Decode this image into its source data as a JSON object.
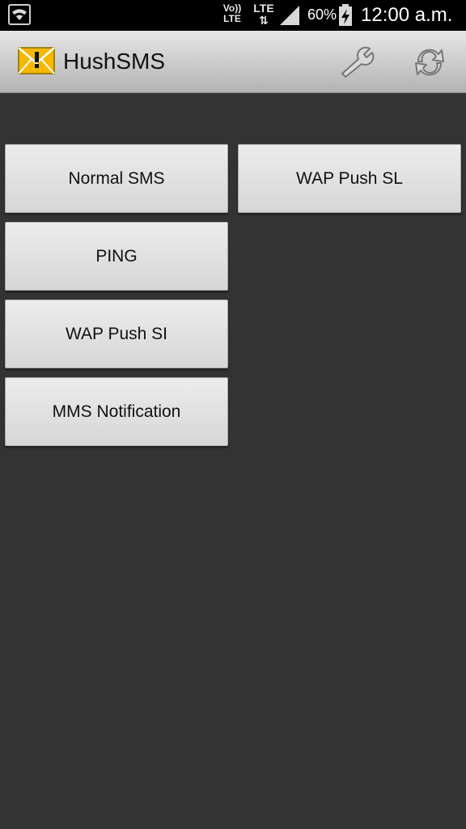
{
  "status_bar": {
    "volte": "Vo)) LTE",
    "network": "LTE",
    "battery_percent": "60%",
    "time": "12:00 a.m.",
    "icons": [
      "wifi-icon",
      "signal-icon",
      "battery-charging-icon"
    ]
  },
  "action_bar": {
    "title": "HushSMS",
    "app_icon": "envelope-warning-icon",
    "actions": [
      "wrench-icon",
      "refresh-icon"
    ],
    "accent_color": "#f5b800"
  },
  "buttons": {
    "normal_sms": "Normal SMS",
    "wap_push_sl": "WAP Push SL",
    "ping": "PING",
    "wap_push_si": "WAP Push SI",
    "mms_notification": "MMS Notification"
  },
  "colors": {
    "background": "#333333",
    "button_face": "#e0e0e0"
  }
}
